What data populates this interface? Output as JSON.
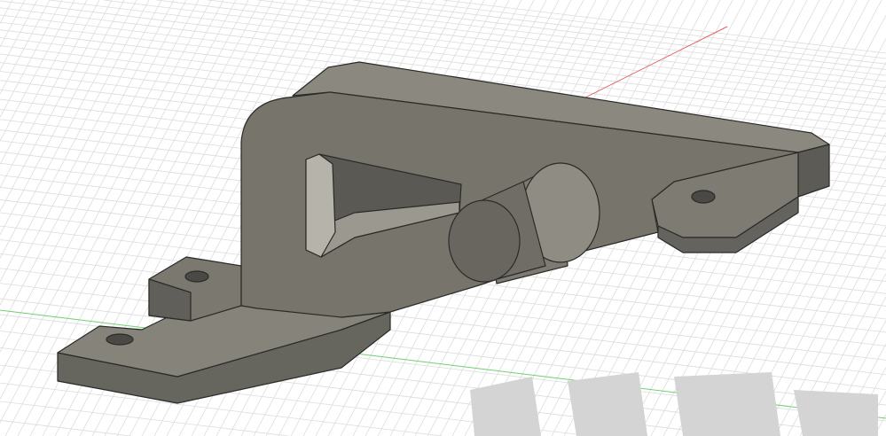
{
  "viewport": {
    "background": "#ffffff",
    "grid_color": "#dcdcdc",
    "x_axis_color": "#e06060",
    "y_axis_color": "#70d070",
    "shadow_color": "#d4d4d4"
  },
  "model": {
    "body_color": "#77756d",
    "top_face_color": "#8b897f",
    "dark_face_color": "#5c5b55",
    "edge_color": "#2a2a28"
  }
}
